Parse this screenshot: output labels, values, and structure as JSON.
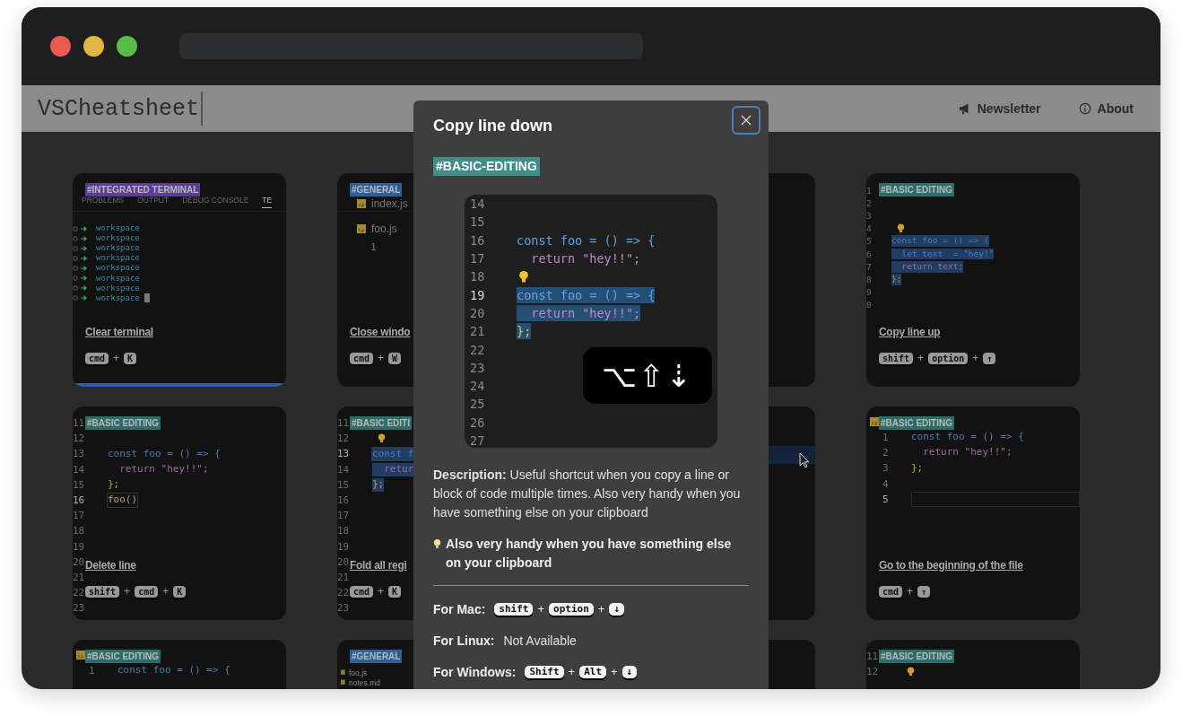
{
  "header": {
    "logo": "VSCheatsheet",
    "links": [
      {
        "kind": "megaphone",
        "label": "Newsletter"
      },
      {
        "kind": "info",
        "label": "About"
      }
    ]
  },
  "cards": [
    {
      "kind": "terminal",
      "tag": "#INTEGRATED TERMINAL",
      "color": "#5b3f97",
      "highlighted": true,
      "tabs": [
        {
          "label": "PROBLEMS",
          "selected": false
        },
        {
          "label": "OUTPUT",
          "selected": false
        },
        {
          "label": "DEBUG CONSOLE",
          "selected": false
        },
        {
          "label": "TE",
          "selected": true
        }
      ],
      "lines": [
        "workspace",
        "workspace",
        "workspace",
        "workspace",
        "workspace",
        "workspace",
        "workspace",
        "workspace"
      ],
      "title": "Clear terminal",
      "keys": [
        "cmd",
        "+",
        "K"
      ]
    },
    {
      "kind": "editor-tabs",
      "tag": "#GENERAL",
      "color": "#2f5f95",
      "files": [
        "index.js",
        "foo.js"
      ],
      "line_number": "1",
      "title": "Close windo",
      "keys": [
        "cmd",
        "+",
        "W"
      ]
    },
    {
      "kind": "empty"
    },
    {
      "kind": "code-small",
      "tag": "#BASIC EDITING",
      "color": "#2e6e69",
      "lines": [
        {
          "n": "1",
          "kind": "blank"
        },
        {
          "n": "2",
          "kind": "blank"
        },
        {
          "n": "3",
          "kind": "blank"
        },
        {
          "n": "4",
          "kind": "bulb"
        },
        {
          "n": "5",
          "kind": "decl",
          "code": "const foo = () => {",
          "selected": true,
          "current": false
        },
        {
          "n": "6",
          "kind": "decl",
          "code": "  let text  = \"hey!\"",
          "selected": true,
          "current": false
        },
        {
          "n": "7",
          "kind": "ret",
          "code": "  return text;",
          "selected": true,
          "current": false
        },
        {
          "n": "8",
          "kind": "close",
          "code": "};",
          "selected": true,
          "current": false
        },
        {
          "n": "9",
          "kind": "blank"
        },
        {
          "n": "0",
          "kind": "blank"
        }
      ],
      "title": "Copy line up",
      "keys": [
        "shift",
        "+",
        "option",
        "+",
        "↑"
      ]
    },
    {
      "kind": "code",
      "tag": "#BASIC EDITING",
      "color": "#2e6e69",
      "lines": [
        {
          "n": "11",
          "kind": "blank"
        },
        {
          "n": "12",
          "kind": "blank"
        },
        {
          "n": "13",
          "kind": "decl",
          "code": "const foo = () => {",
          "selected": false,
          "current": false
        },
        {
          "n": "14",
          "kind": "ret",
          "code": "  return \"hey!!\";",
          "selected": false,
          "current": false
        },
        {
          "n": "15",
          "kind": "close",
          "code": "};",
          "selected": false,
          "current": false
        },
        {
          "n": "16",
          "kind": "call",
          "code": "foo()",
          "selected": false,
          "current": true
        },
        {
          "n": "17",
          "kind": "blank"
        },
        {
          "n": "18",
          "kind": "blank"
        },
        {
          "n": "19",
          "kind": "blank"
        },
        {
          "n": "20",
          "kind": "blank"
        },
        {
          "n": "21",
          "kind": "blank"
        },
        {
          "n": "22",
          "kind": "blank"
        },
        {
          "n": "23",
          "kind": "blank"
        }
      ],
      "title": "Delete line",
      "keys": [
        "shift",
        "+",
        "cmd",
        "+",
        "K"
      ]
    },
    {
      "kind": "code",
      "tag": "#BASIC EDITI",
      "color": "#2e6e69",
      "lines": [
        {
          "n": "11",
          "kind": "blank"
        },
        {
          "n": "12",
          "kind": "bulb"
        },
        {
          "n": "13",
          "kind": "decl",
          "code": "const f",
          "selected": true,
          "current": true
        },
        {
          "n": "14",
          "kind": "ret",
          "code": "  retur",
          "selected": true,
          "current": false
        },
        {
          "n": "15",
          "kind": "close",
          "code": "};",
          "selected": true,
          "current": false
        },
        {
          "n": "16",
          "kind": "blank"
        },
        {
          "n": "17",
          "kind": "blank"
        },
        {
          "n": "18",
          "kind": "blank"
        },
        {
          "n": "19",
          "kind": "blank"
        },
        {
          "n": "20",
          "kind": "blank"
        },
        {
          "n": "21",
          "kind": "blank"
        },
        {
          "n": "22",
          "kind": "blank"
        },
        {
          "n": "23",
          "kind": "blank"
        }
      ],
      "title": "Fold all regi",
      "keys": [
        "cmd",
        "+",
        "K"
      ]
    },
    {
      "kind": "band"
    },
    {
      "kind": "code",
      "tag": "#BASIC EDITING",
      "color": "#2e6e69",
      "file_icon": true,
      "lines": [
        {
          "n": "1",
          "kind": "decl",
          "code": "const foo = () => {",
          "selected": false,
          "current": false
        },
        {
          "n": "2",
          "kind": "ret",
          "code": "  return \"hey!!\";",
          "selected": false,
          "current": false
        },
        {
          "n": "3",
          "kind": "close",
          "code": "};",
          "selected": false,
          "current": false
        },
        {
          "n": "4",
          "kind": "blank"
        },
        {
          "n": "5",
          "kind": "blank",
          "current": true
        }
      ],
      "title": "Go to the beginning of the file",
      "keys": [
        "cmd",
        "+",
        "↑"
      ]
    },
    {
      "kind": "code",
      "tag": "#BASIC EDITING",
      "color": "#2e6e69",
      "file_icon": true,
      "lines": [
        {
          "n": "1",
          "kind": "decl",
          "code": "const foo = () => {",
          "selected": false,
          "current": false
        }
      ]
    },
    {
      "kind": "files",
      "tag": "#GENERAL",
      "color": "#2f5f95",
      "files": [
        "foo.js",
        "notes.md"
      ]
    },
    {
      "kind": "empty"
    },
    {
      "kind": "code",
      "tag": "#BASIC EDITING",
      "color": "#2e6e69",
      "lines": [
        {
          "n": "11",
          "kind": "blank"
        },
        {
          "n": "12",
          "kind": "bulb"
        }
      ]
    }
  ],
  "modal": {
    "title": "Copy line down",
    "tag": "#BASIC-EDITING",
    "color": "#3f8f89",
    "preview": {
      "lines": [
        {
          "n": "14",
          "kind": "blank"
        },
        {
          "n": "15",
          "kind": "blank"
        },
        {
          "n": "16",
          "kind": "decl",
          "code": "const foo = () => {",
          "selected": false,
          "current": false
        },
        {
          "n": "17",
          "kind": "ret",
          "code": "  return \"hey!!\";",
          "selected": false,
          "current": false
        },
        {
          "n": "18",
          "kind": "bulb"
        },
        {
          "n": "19",
          "kind": "decl",
          "code": "const foo = () => {",
          "selected": true,
          "current": true
        },
        {
          "n": "20",
          "kind": "ret",
          "code": "  return \"hey!!\";",
          "selected": true,
          "current": false
        },
        {
          "n": "21",
          "kind": "close",
          "code": "};",
          "selected": true,
          "current": false
        },
        {
          "n": "22",
          "kind": "blank"
        },
        {
          "n": "23",
          "kind": "blank"
        },
        {
          "n": "24",
          "kind": "blank"
        },
        {
          "n": "25",
          "kind": "blank"
        },
        {
          "n": "26",
          "kind": "blank"
        },
        {
          "n": "27",
          "kind": "blank"
        }
      ],
      "keys": "⌥⇧⇣"
    },
    "description": "**Description:** Useful shortcut when you copy a line or block of code multiple times. Also very handy when you have something else on your clipboard",
    "tip": "Also very handy when you have something else on your clipboard",
    "shortcuts": [
      {
        "platform": "For Mac:",
        "keys": [
          "shift",
          "+",
          "option",
          "+",
          "↓"
        ]
      },
      {
        "platform": "For Linux:",
        "text": "Not Available"
      },
      {
        "platform": "For Windows:",
        "keys": [
          "Shift",
          "+",
          "Alt",
          "+",
          "↓"
        ]
      }
    ]
  }
}
